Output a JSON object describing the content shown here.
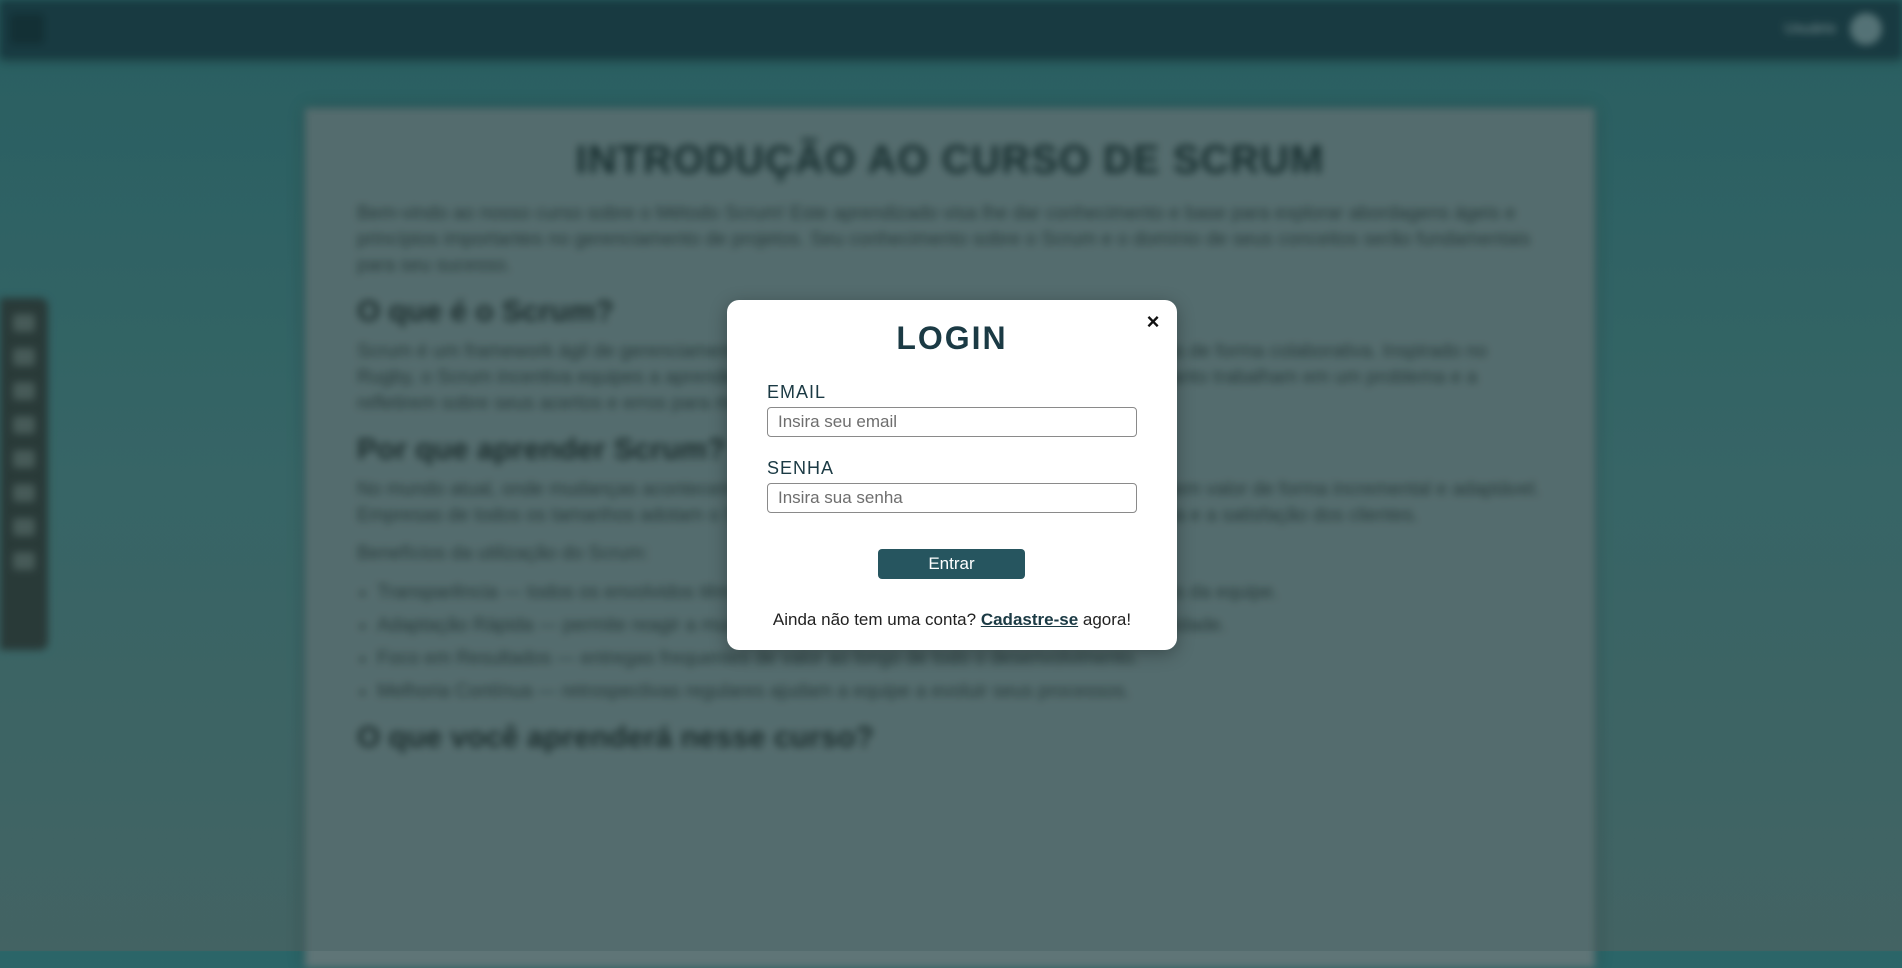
{
  "background": {
    "topbar": {
      "user_label": "Usuário"
    },
    "page_title": "INTRODUÇÃO AO CURSO DE SCRUM",
    "intro_paragraph": "Bem-vindo ao nosso curso sobre o Método Scrum! Este aprendizado visa lhe dar conhecimento e base para explorar abordagens ágeis e princípios importantes no gerenciamento de projetos. Seu conhecimento sobre o Scrum e o domínio de seus conceitos serão fundamentais para seu sucesso.",
    "section_1": {
      "heading": "O que é o Scrum?",
      "paragraph": "Scrum é um framework ágil de gerenciamento de projetos que ajuda equipes a trabalharem juntas de forma colaborativa. Inspirado no Rugby, o Scrum incentiva equipes a aprenderem com suas experiências, a se organizarem enquanto trabalham em um problema e a refletirem sobre seus acertos e erros para melhorar continuamente."
    },
    "section_2": {
      "heading": "Por que aprender Scrum?",
      "paragraph": "No mundo atual, onde mudanças acontecem rapidamente, o Scrum permite que equipes entreguem valor de forma incremental e adaptável. Empresas de todos os tamanhos adotam o Scrum para aumentar a produtividade, a transparência e a satisfação dos clientes.",
      "list_intro": "Benefícios da utilização do Scrum:",
      "items": [
        "Transparência — todos os envolvidos têm visão clara do progresso do projeto e das prioridades da equipe.",
        "Adaptação Rápida — permite reagir a mudanças de mercado e feedback dos clientes com agilidade.",
        "Foco em Resultados — entregas frequentes de valor ao longo de todo o desenvolvimento.",
        "Melhoria Contínua — retrospectivas regulares ajudam a equipe a evoluir seus processos."
      ]
    },
    "section_3": {
      "heading": "O que você aprenderá nesse curso?"
    }
  },
  "modal": {
    "title": "LOGIN",
    "close_symbol": "×",
    "email": {
      "label": "EMAIL",
      "placeholder": "Insira seu email",
      "value": ""
    },
    "password": {
      "label": "SENHA",
      "placeholder": "Insira sua senha",
      "value": ""
    },
    "submit_label": "Entrar",
    "signup": {
      "prefix": "Ainda não tem uma conta? ",
      "link_label": "Cadastre-se",
      "suffix": " agora!"
    }
  },
  "colors": {
    "brand_dark": "#1b3a44",
    "button": "#26555f",
    "topbar": "#183a42"
  }
}
